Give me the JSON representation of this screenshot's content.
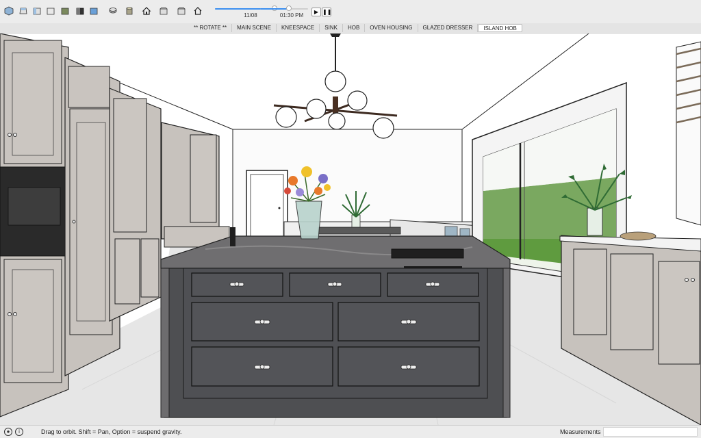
{
  "toolbar": {
    "icons": [
      "iso-view-icon",
      "top-view-icon",
      "front-view-icon",
      "right-view-icon",
      "back-view-icon",
      "left-view-icon",
      "xray-icon",
      "wireframe-icon",
      "shaded-icon",
      "textured-icon",
      "monochrome-icon",
      "previous-scene-icon",
      "next-scene-icon",
      "home-icon"
    ],
    "date_label": "11/08",
    "time_label": "01:30 PM",
    "date_fraction": 0.87,
    "time_fraction": 0.6
  },
  "scene_tabs": [
    {
      "label": "** ROTATE **",
      "active": false
    },
    {
      "label": "MAIN SCENE",
      "active": false
    },
    {
      "label": "KNEESPACE",
      "active": false
    },
    {
      "label": "SINK",
      "active": false
    },
    {
      "label": "HOB",
      "active": false
    },
    {
      "label": "OVEN HOUSING",
      "active": false
    },
    {
      "label": "GLAZED DRESSER",
      "active": false
    },
    {
      "label": "ISLAND HOB",
      "active": true
    }
  ],
  "statusbar": {
    "hint": "Drag to orbit. Shift = Pan, Option = suspend gravity.",
    "measurements_label": "Measurements",
    "measurements_value": ""
  },
  "colors": {
    "cabinet": "#c7c2bd",
    "island": "#4e4f52",
    "worktop": "#6f6e70",
    "floor": "#e6e6e6",
    "grass": "#5f9b3f",
    "hedge": "#7aa860",
    "accent": "#3b8ef0"
  }
}
